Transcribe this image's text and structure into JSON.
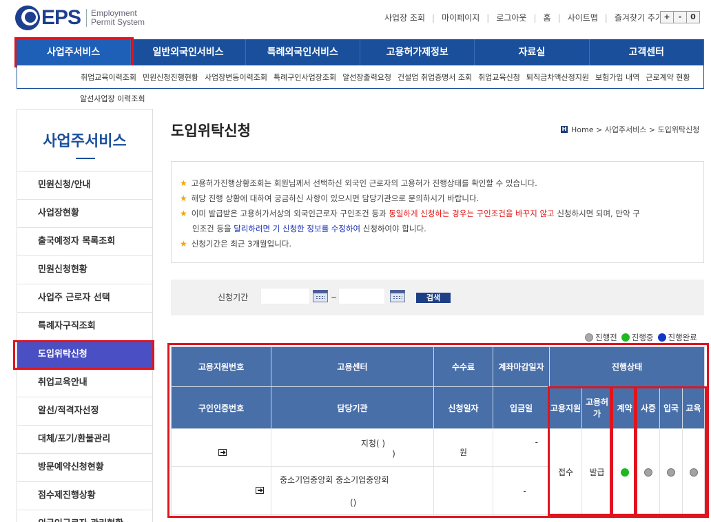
{
  "header": {
    "logo_text": "EPS",
    "logo_sub1": "Employment",
    "logo_sub2": "Permit System",
    "util_links": [
      "사업장 조회",
      "마이페이지",
      "로그아웃",
      "홈",
      "사이트맵",
      "즐겨찾기 추가"
    ],
    "zoom": [
      "+",
      "-",
      "0"
    ]
  },
  "gnb": [
    "사업주서비스",
    "일반외국인서비스",
    "특례외국인서비스",
    "고용허가제정보",
    "자료실",
    "고객센터"
  ],
  "subnav": {
    "items": [
      "취업교육이력조회",
      "민원신청진행현황",
      "사업장변동이력조회",
      "특례구인사업장조회",
      "알선장출력요청",
      "건설업 취업증명서 조회",
      "취업교육신청",
      "퇴직금차액산정지원",
      "보험가입 내역",
      "근로계약 현황"
    ],
    "row2": "알선사업장 이력조회"
  },
  "sidebar": {
    "title": "사업주서비스",
    "items": [
      "민원신청/안내",
      "사업장현황",
      "출국예정자 목록조회",
      "민원신청현황",
      "사업주 근로자 선택",
      "특례자구직조회",
      "도입위탁신청",
      "취업교육안내",
      "알선/적격자선정",
      "대체/포기/환불관리",
      "방문예약신청현황",
      "점수제진행상황",
      "외국인근로자 관리현황"
    ]
  },
  "page": {
    "title": "도입위탁신청",
    "breadcrumb": "Home > 사업주서비스 > 도입위탁신청"
  },
  "notice": {
    "line1": "고용허가진행상황조회는 회원님께서 선택하신 외국인 근로자의 고용허가 진행상태를 확인할 수 있습니다.",
    "line2": "해당 진행 상황에 대하여 궁금하신 사항이 있으시면 담당기관으로 문의하시기 바랍니다.",
    "line3_a": "이미 발급받은 고용허가서상의 외국인근로자 구인조건 등과 ",
    "line3_b": "동일하게 신청하는 경우는 구인조건을 바꾸지 않고",
    "line3_c": " 신청하시면 되며, 만약 구",
    "line4_a": "인조건 등을 ",
    "line4_b": "달리하려면 기 신청한 정보를 수정하여",
    "line4_c": " 신청하여야 합니다.",
    "line5": "신청기간은 최근 3개월입니다."
  },
  "search": {
    "label": "신청기간",
    "from": "",
    "to": "",
    "tilde": "~",
    "button": "검색"
  },
  "legend": [
    "진행전",
    "진행중",
    "진행완료"
  ],
  "colors": {
    "grey": "#a9a9a9",
    "green": "#1fb81f",
    "navy": "#1436c4",
    "header_bg": "#496fa9",
    "highlight": "#e0141e"
  },
  "table": {
    "h1": [
      "고용지원번호",
      "고용센터",
      "수수료",
      "계좌마감일자",
      "진행상태"
    ],
    "h2": [
      "구인인증번호",
      "담당기관",
      "신청일자",
      "입금일"
    ],
    "status_cols": [
      "고용지원",
      "고용허가",
      "계약",
      "사증",
      "입국",
      "교육"
    ],
    "row": {
      "center": "지청(      )",
      "center2": ")",
      "fee": "원",
      "deadline": "-",
      "agency": "중소기업중앙회 중소기업중앙회",
      "agency2": "()",
      "deposit": "-",
      "statuses": [
        "접수",
        "발급"
      ],
      "dots": [
        "green",
        "grey",
        "grey",
        "grey"
      ]
    }
  }
}
